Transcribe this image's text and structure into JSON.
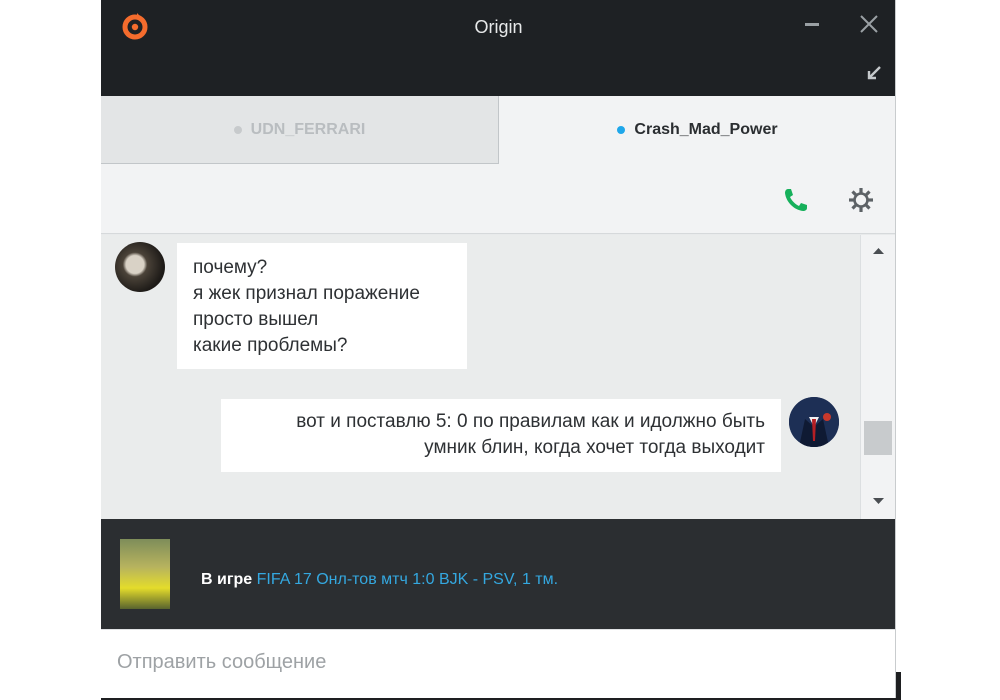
{
  "window": {
    "title": "Origin",
    "logo_icon": "origin-logo-icon",
    "controls": [
      "minimize-icon",
      "close-icon",
      "pop-in-icon"
    ]
  },
  "tabs": [
    {
      "label": "UDN_FERRARI",
      "status_color": "#c7cacc",
      "active": false
    },
    {
      "label": "Crash_Mad_Power",
      "status_color": "#1fa7ea",
      "active": true
    }
  ],
  "toolbar": {
    "call_icon": "phone-icon",
    "settings_icon": "gear-icon",
    "call_color": "#16b05b"
  },
  "messages": [
    {
      "sender": "them",
      "lines": [
        "почему?",
        "я жек признал поражение",
        "просто вышел",
        "какие проблемы?"
      ]
    },
    {
      "sender": "me",
      "lines": [
        "вот и поставлю 5: 0 по правилам как и идолжно быть",
        "умник блин, когда хочет тогда выходит"
      ]
    }
  ],
  "now_playing": {
    "prefix": "В игре",
    "game_text": "FIFA 17 Онл-тов мтч 1:0 BJK - PSV, 1 тм.",
    "link_color": "#34a8e0"
  },
  "composer": {
    "placeholder": "Отправить сообщение",
    "value": ""
  },
  "colors": {
    "titlebar": "#1e2124",
    "accent": "#f56c2d",
    "now_playing_bg": "#2b2e31"
  }
}
